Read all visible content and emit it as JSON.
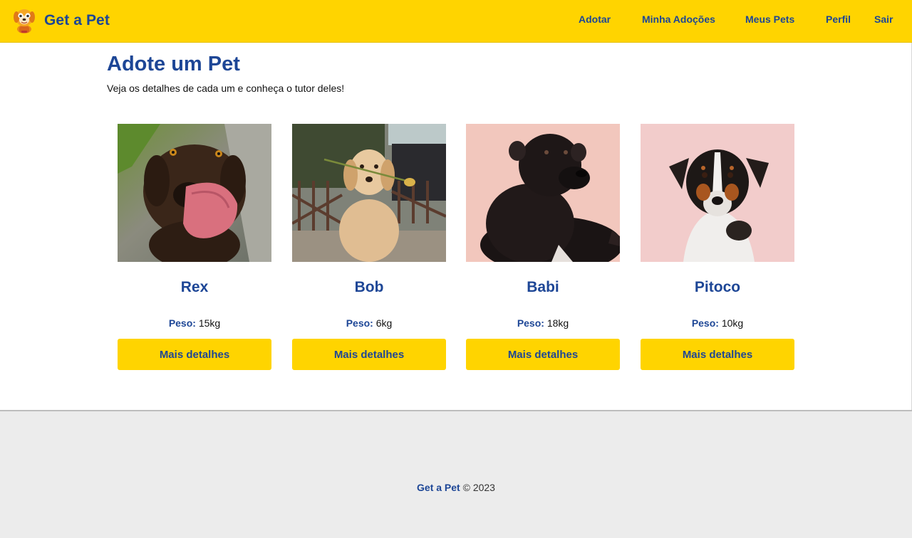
{
  "navbar": {
    "brand": "Get a Pet",
    "logo_icon": "dog-logo-icon",
    "links": [
      "Adotar",
      "Minha Adoções",
      "Meus Pets",
      "Perfil",
      "Sair"
    ]
  },
  "main": {
    "title": "Adote um Pet",
    "subtitle": "Veja os detalhes de cada um e conheça o tutor deles!"
  },
  "pets": [
    {
      "name": "Rex",
      "weight_label": "Peso:",
      "weight": "15kg",
      "button": "Mais detalhes"
    },
    {
      "name": "Bob",
      "weight_label": "Peso:",
      "weight": "6kg",
      "button": "Mais detalhes"
    },
    {
      "name": "Babi",
      "weight_label": "Peso:",
      "weight": "18kg",
      "button": "Mais detalhes"
    },
    {
      "name": "Pitoco",
      "weight_label": "Peso:",
      "weight": "10kg",
      "button": "Mais detalhes"
    }
  ],
  "footer": {
    "brand": "Get a Pet",
    "copyright": "© 2023"
  },
  "colors": {
    "accent_yellow": "#FFD400",
    "brand_blue": "#1D4696",
    "footer_bg": "#ECECEC"
  }
}
